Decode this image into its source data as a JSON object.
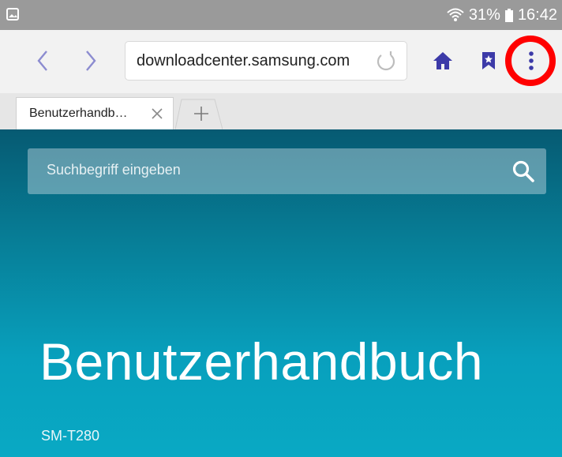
{
  "status_bar": {
    "battery": "31%",
    "time": "16:42",
    "left_icon": "gallery-icon",
    "right_icons": [
      "wifi-icon",
      "battery-icon"
    ]
  },
  "toolbar": {
    "url": "downloadcenter.samsung.com",
    "icons": [
      "back-icon",
      "forward-icon",
      "reload-icon",
      "home-icon",
      "bookmark-icon",
      "more-menu-icon"
    ],
    "accent_color": "#3c3aa8",
    "highlight_color": "#ff0000"
  },
  "tabs": {
    "items": [
      {
        "label": "Benutzerhandb…",
        "active": true
      }
    ],
    "new_tab_icon": "plus-icon"
  },
  "page": {
    "search_placeholder": "Suchbegriff eingeben",
    "title": "Benutzerhandbuch",
    "model": "SM-T280",
    "background_colors": [
      "#065a72",
      "#09a9c4"
    ]
  }
}
